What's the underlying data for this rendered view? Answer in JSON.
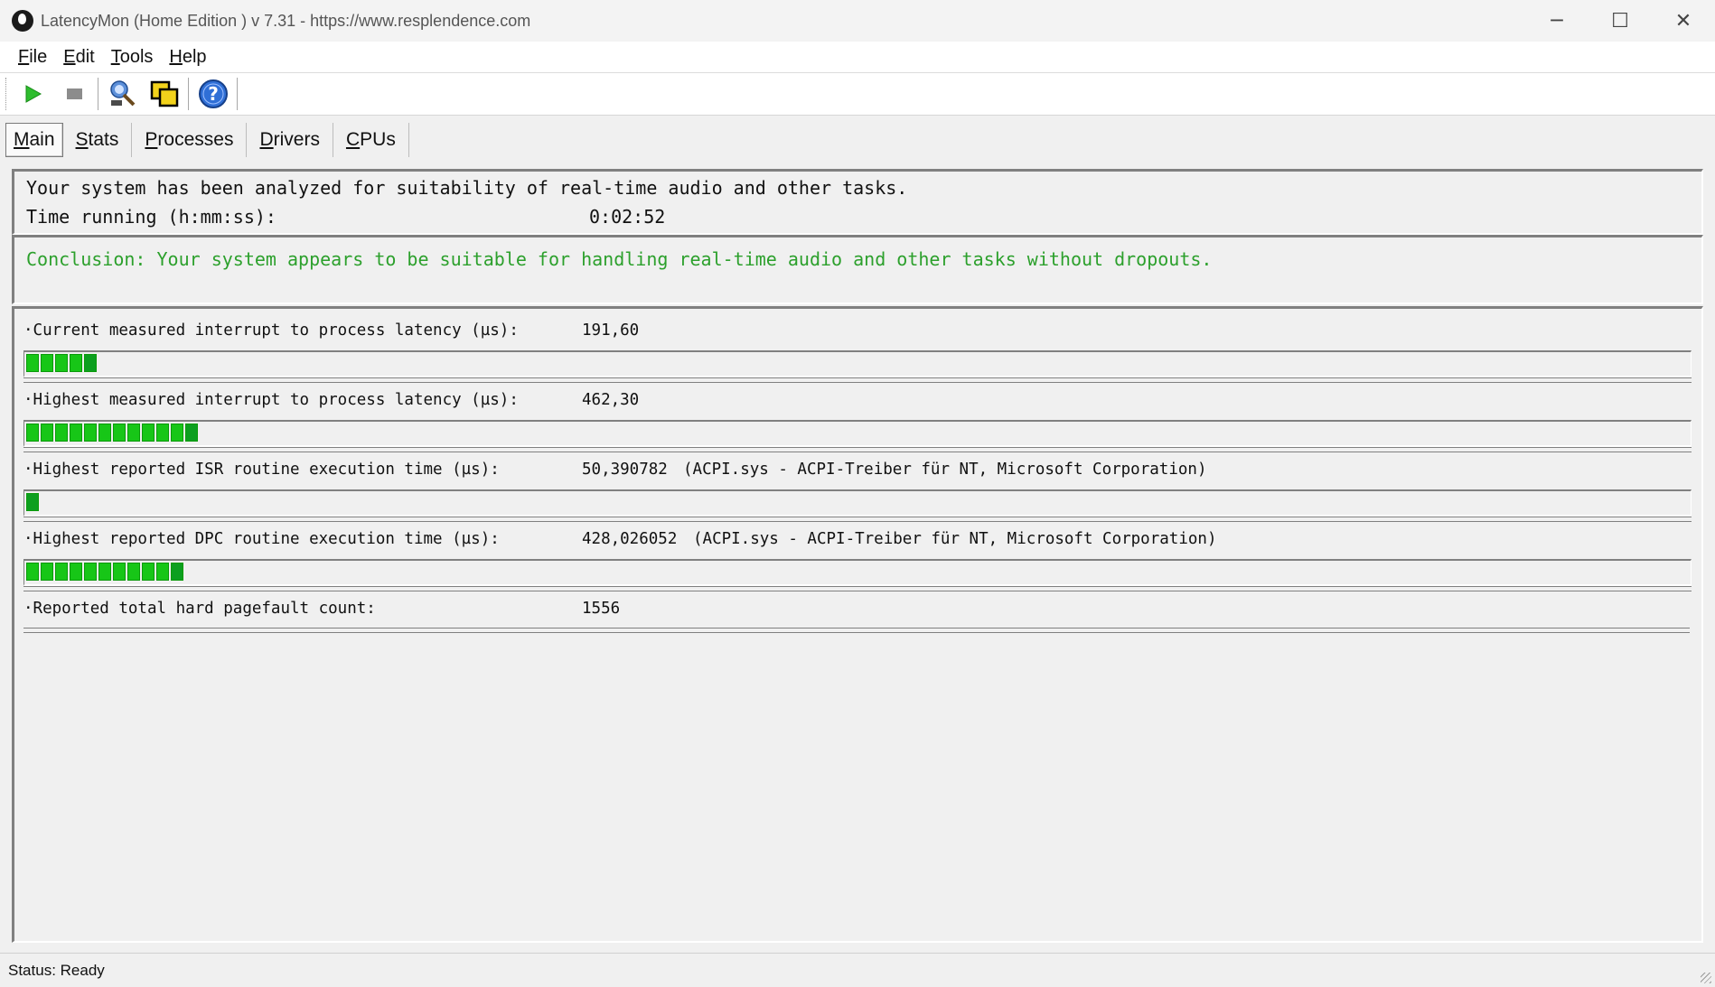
{
  "window": {
    "title": "LatencyMon  (Home Edition )  v 7.31 - https://www.resplendence.com",
    "minimize": "─",
    "maximize": "☐",
    "close": "✕"
  },
  "menu": [
    {
      "label": "File",
      "accel": "F",
      "rest": "ile"
    },
    {
      "label": "Edit",
      "accel": "E",
      "rest": "dit"
    },
    {
      "label": "Tools",
      "accel": "T",
      "rest": "ools"
    },
    {
      "label": "Help",
      "accel": "H",
      "rest": "elp"
    }
  ],
  "toolbar": {
    "start": "start-icon",
    "stop": "stop-icon",
    "wizard": "wizard-icon",
    "copy": "copy-windows-icon",
    "help": "help-icon"
  },
  "tabs": [
    {
      "label": "Main",
      "accel": "M",
      "rest": "ain",
      "active": true
    },
    {
      "label": "Stats",
      "accel": "S",
      "rest": "tats"
    },
    {
      "label": "Processes",
      "accel": "P",
      "rest": "rocesses"
    },
    {
      "label": "Drivers",
      "accel": "D",
      "rest": "rivers"
    },
    {
      "label": "CPUs",
      "accel": "C",
      "rest": "PUs"
    }
  ],
  "summary": {
    "line1": "Your system has been analyzed for suitability of real-time audio and other tasks.",
    "time_label": "Time running (h:mm:ss):",
    "time_value": "0:02:52",
    "conclusion": "Conclusion: Your system appears to be suitable for handling real-time audio and other tasks without dropouts."
  },
  "metrics": [
    {
      "label": "·Current measured interrupt to process latency (µs):",
      "value": "191,60",
      "note": "",
      "segments": 5
    },
    {
      "label": "·Highest measured interrupt to process latency (µs):",
      "value": "462,30",
      "note": "",
      "segments": 12
    },
    {
      "label": "·Highest reported ISR routine execution time (µs):",
      "value": "50,390782",
      "note": "(ACPI.sys - ACPI-Treiber für NT, Microsoft Corporation)",
      "segments": 1
    },
    {
      "label": "·Highest reported DPC routine execution time (µs):",
      "value": "428,026052",
      "note": "(ACPI.sys - ACPI-Treiber für NT, Microsoft Corporation)",
      "segments": 11
    },
    {
      "label": "·Reported total hard pagefault count:",
      "value": "1556",
      "note": "",
      "segments": 0
    }
  ],
  "status": "Status: Ready",
  "colors": {
    "accent_green": "#17c617",
    "conclusion_green": "#2ca02c"
  }
}
